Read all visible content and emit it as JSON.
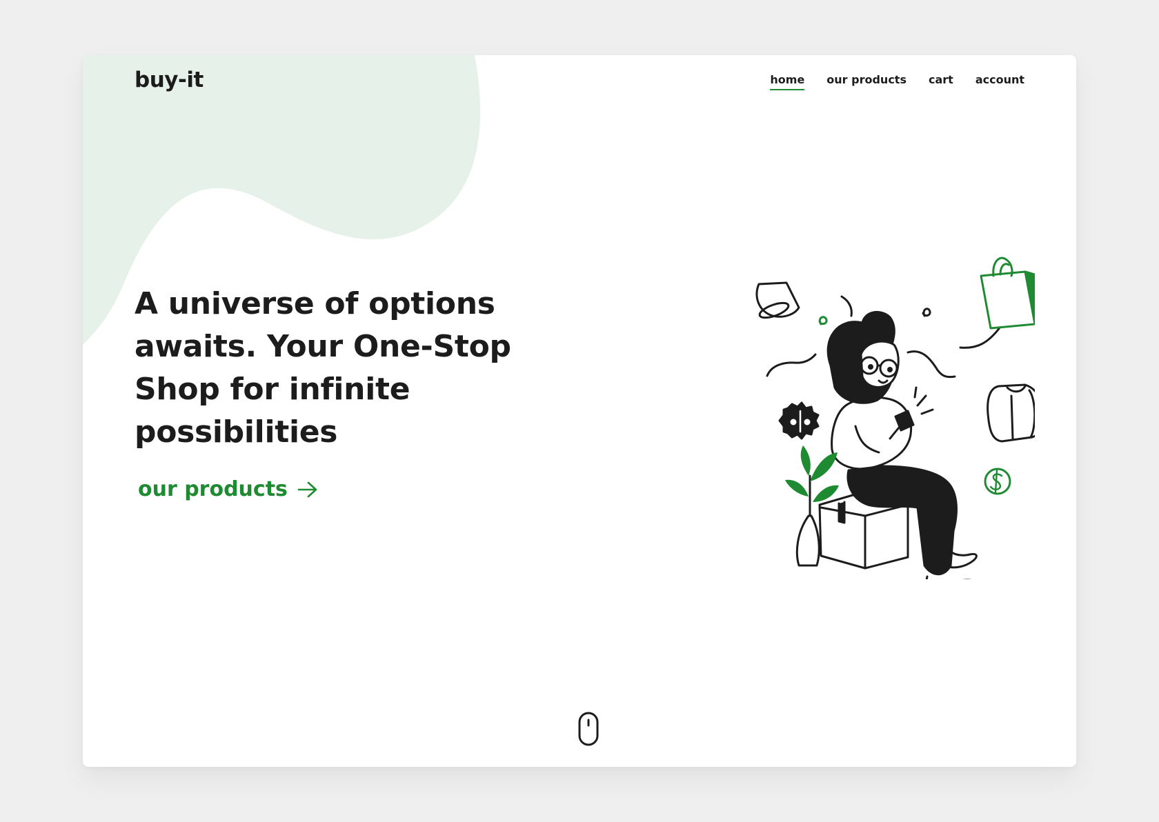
{
  "brand": {
    "name": "buy-it"
  },
  "nav": {
    "items": [
      {
        "label": "home",
        "active": true
      },
      {
        "label": "our products",
        "active": false
      },
      {
        "label": "cart",
        "active": false
      },
      {
        "label": "account",
        "active": false
      }
    ]
  },
  "hero": {
    "headline": "A universe of options awaits. Your One-Stop Shop for infinite possibilities",
    "cta_label": "our products"
  },
  "icons": {
    "cta_arrow": "arrow-right-icon",
    "scroll": "mouse-scroll-icon",
    "illustration": "woman-shopping-on-phone-illustration"
  },
  "colors": {
    "accent": "#1e8a32",
    "blob": "#e6f1e9",
    "text": "#1c1c1c",
    "page_background": "#efefef",
    "card_background": "#ffffff"
  }
}
